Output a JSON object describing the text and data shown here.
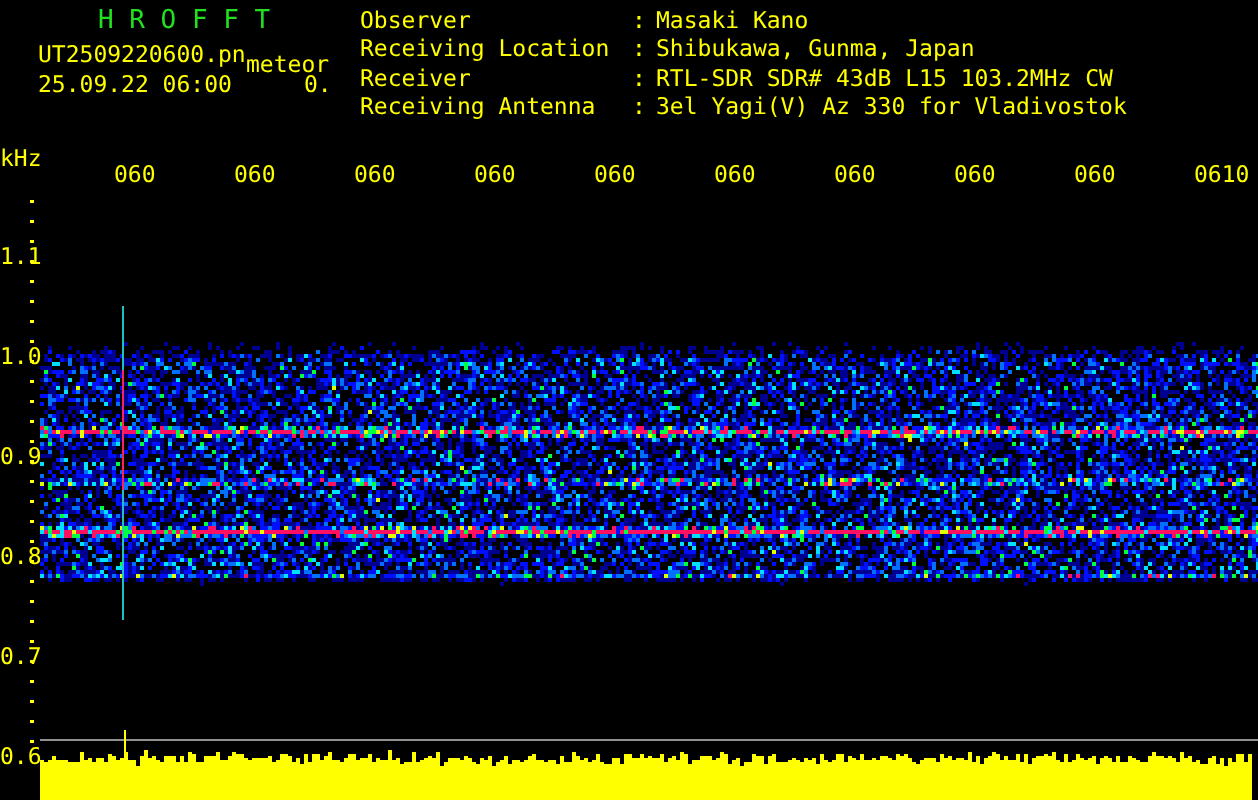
{
  "header": {
    "title": "H R O F F T",
    "filename": "UT2509220600.pn",
    "detection_label": "meteor",
    "datetime": "25.09.22 06:00",
    "detection_count": "0."
  },
  "station_info": [
    {
      "label": "Observer",
      "separator": ":",
      "value": "Masaki Kano"
    },
    {
      "label": "Receiving Location",
      "separator": ":",
      "value": "Shibukawa, Gunma, Japan"
    },
    {
      "label": "Receiver",
      "separator": ":",
      "value": "RTL-SDR SDR# 43dB L15 103.2MHz CW"
    },
    {
      "label": "Receiving Antenna",
      "separator": ":",
      "value": "3el Yagi(V) Az 330 for Vladivostok"
    }
  ],
  "time_axis": {
    "ticks": [
      "060",
      "060",
      "060",
      "060",
      "060",
      "060",
      "060",
      "060",
      "060",
      "0610"
    ]
  },
  "freq_axis": {
    "unit": "kHz",
    "ticks": [
      "1.1",
      "1.0",
      "0.9",
      "0.8",
      "0.7",
      "0.6"
    ]
  }
}
